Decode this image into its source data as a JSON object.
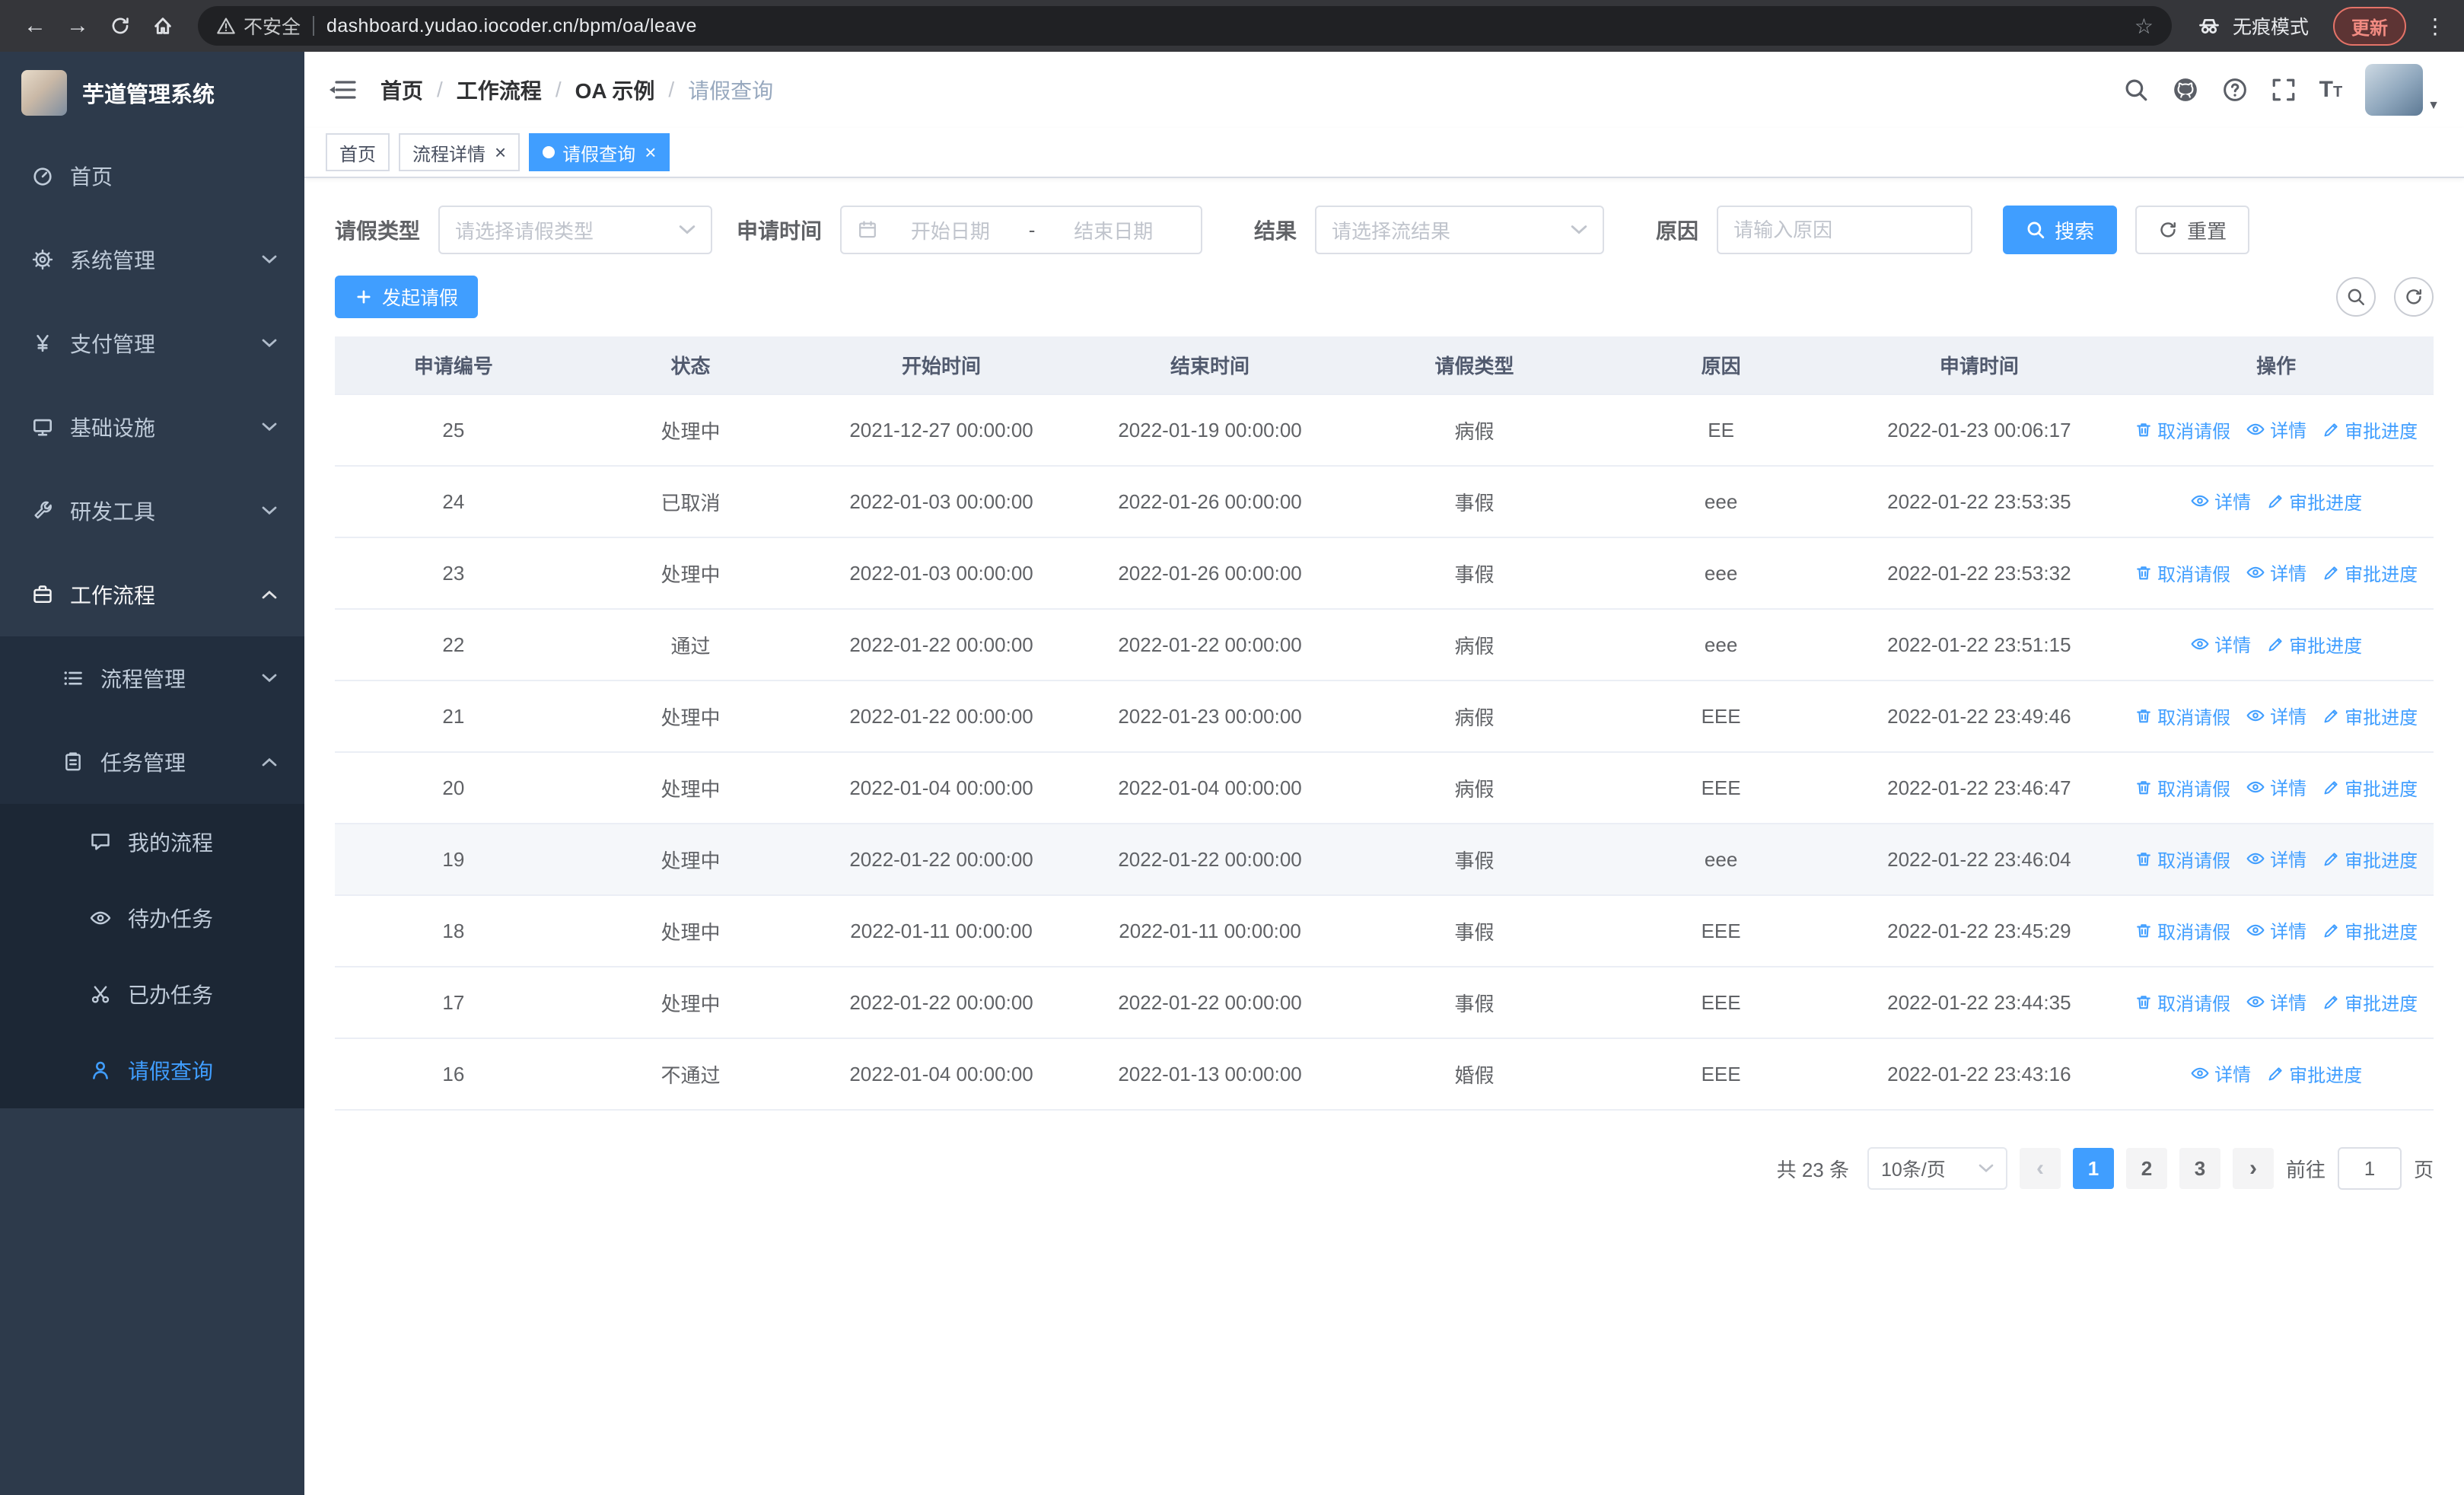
{
  "browser": {
    "security_label": "不安全",
    "url": "dashboard.yudao.iocoder.cn/bpm/oa/leave",
    "incognito_label": "无痕模式",
    "update_label": "更新"
  },
  "sidebar": {
    "title": "芋道管理系统",
    "top_items": [
      {
        "label": "首页"
      },
      {
        "label": "系统管理"
      },
      {
        "label": "支付管理"
      },
      {
        "label": "基础设施"
      },
      {
        "label": "研发工具"
      },
      {
        "label": "工作流程"
      }
    ],
    "workflow_children": [
      {
        "label": "流程管理"
      },
      {
        "label": "任务管理"
      }
    ],
    "task_children": [
      {
        "label": "我的流程"
      },
      {
        "label": "待办任务"
      },
      {
        "label": "已办任务"
      },
      {
        "label": "请假查询"
      }
    ]
  },
  "breadcrumb": {
    "items": [
      "首页",
      "工作流程",
      "OA 示例",
      "请假查询"
    ]
  },
  "tags": [
    {
      "label": "首页"
    },
    {
      "label": "流程详情"
    },
    {
      "label": "请假查询"
    }
  ],
  "filters": {
    "leave_type_label": "请假类型",
    "leave_type_placeholder": "请选择请假类型",
    "apply_time_label": "申请时间",
    "start_date_placeholder": "开始日期",
    "date_separator": "-",
    "end_date_placeholder": "结束日期",
    "result_label": "结果",
    "result_placeholder": "请选择流结果",
    "reason_label": "原因",
    "reason_placeholder": "请输入原因",
    "search_label": "搜索",
    "reset_label": "重置"
  },
  "toolbar": {
    "create_label": "发起请假"
  },
  "table": {
    "columns": [
      "申请编号",
      "状态",
      "开始时间",
      "结束时间",
      "请假类型",
      "原因",
      "申请时间",
      "操作"
    ],
    "actions": {
      "cancel": "取消请假",
      "detail": "详情",
      "progress": "审批进度"
    },
    "rows": [
      {
        "id": "25",
        "status": "处理中",
        "start": "2021-12-27 00:00:00",
        "end": "2022-01-19 00:00:00",
        "type": "病假",
        "reason": "EE",
        "applied": "2022-01-23 00:06:17",
        "can_cancel": true,
        "highlight": false
      },
      {
        "id": "24",
        "status": "已取消",
        "start": "2022-01-03 00:00:00",
        "end": "2022-01-26 00:00:00",
        "type": "事假",
        "reason": "eee",
        "applied": "2022-01-22 23:53:35",
        "can_cancel": false,
        "highlight": false
      },
      {
        "id": "23",
        "status": "处理中",
        "start": "2022-01-03 00:00:00",
        "end": "2022-01-26 00:00:00",
        "type": "事假",
        "reason": "eee",
        "applied": "2022-01-22 23:53:32",
        "can_cancel": true,
        "highlight": false
      },
      {
        "id": "22",
        "status": "通过",
        "start": "2022-01-22 00:00:00",
        "end": "2022-01-22 00:00:00",
        "type": "病假",
        "reason": "eee",
        "applied": "2022-01-22 23:51:15",
        "can_cancel": false,
        "highlight": false
      },
      {
        "id": "21",
        "status": "处理中",
        "start": "2022-01-22 00:00:00",
        "end": "2022-01-23 00:00:00",
        "type": "病假",
        "reason": "EEE",
        "applied": "2022-01-22 23:49:46",
        "can_cancel": true,
        "highlight": false
      },
      {
        "id": "20",
        "status": "处理中",
        "start": "2022-01-04 00:00:00",
        "end": "2022-01-04 00:00:00",
        "type": "病假",
        "reason": "EEE",
        "applied": "2022-01-22 23:46:47",
        "can_cancel": true,
        "highlight": false
      },
      {
        "id": "19",
        "status": "处理中",
        "start": "2022-01-22 00:00:00",
        "end": "2022-01-22 00:00:00",
        "type": "事假",
        "reason": "eee",
        "applied": "2022-01-22 23:46:04",
        "can_cancel": true,
        "highlight": true
      },
      {
        "id": "18",
        "status": "处理中",
        "start": "2022-01-11 00:00:00",
        "end": "2022-01-11 00:00:00",
        "type": "事假",
        "reason": "EEE",
        "applied": "2022-01-22 23:45:29",
        "can_cancel": true,
        "highlight": false
      },
      {
        "id": "17",
        "status": "处理中",
        "start": "2022-01-22 00:00:00",
        "end": "2022-01-22 00:00:00",
        "type": "事假",
        "reason": "EEE",
        "applied": "2022-01-22 23:44:35",
        "can_cancel": true,
        "highlight": false
      },
      {
        "id": "16",
        "status": "不通过",
        "start": "2022-01-04 00:00:00",
        "end": "2022-01-13 00:00:00",
        "type": "婚假",
        "reason": "EEE",
        "applied": "2022-01-22 23:43:16",
        "can_cancel": false,
        "highlight": false
      }
    ]
  },
  "pagination": {
    "total_label": "共 23 条",
    "page_size": "10条/页",
    "pages": [
      "1",
      "2",
      "3"
    ],
    "goto_label": "前往",
    "goto_value": "1",
    "page_suffix": "页"
  },
  "colors": {
    "primary": "#409eff",
    "sidebar_bg": "#2d3a4b",
    "table_header_bg": "#eef1f6",
    "chrome_bg": "#35363a"
  }
}
